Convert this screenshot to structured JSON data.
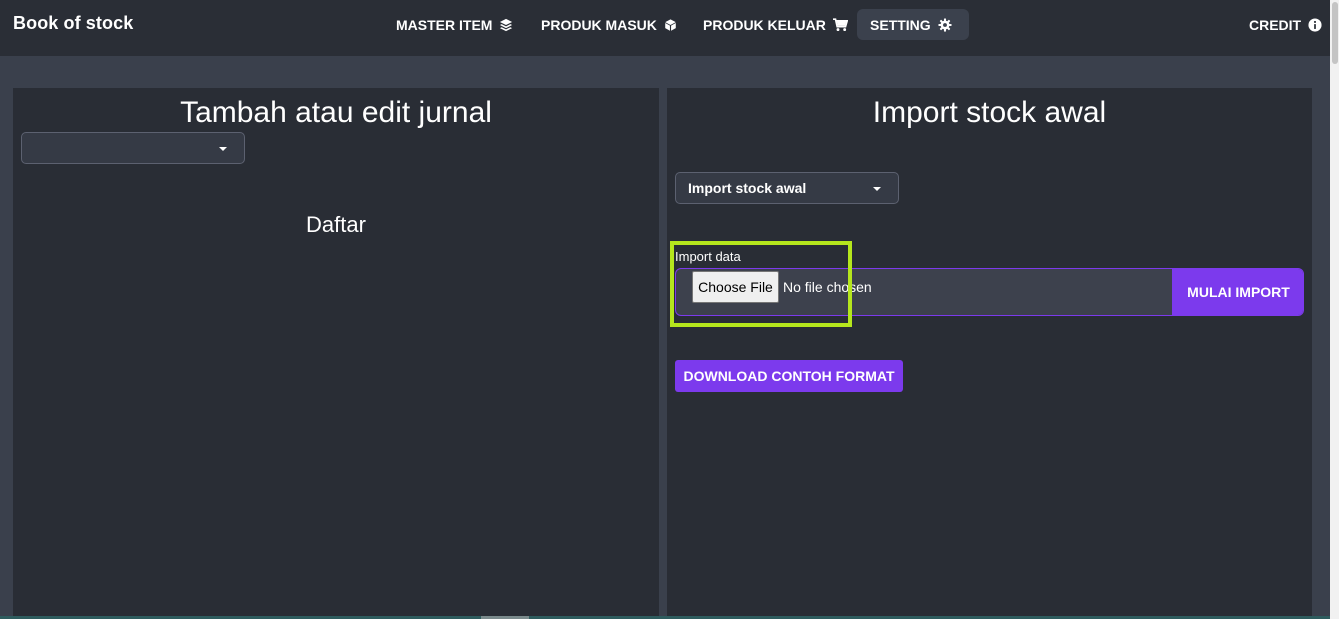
{
  "brand": "Book of stock",
  "nav": {
    "master_item": "MASTER ITEM",
    "produk_masuk": "PRODUK MASUK",
    "produk_keluar": "PRODUK KELUAR",
    "setting": "SETTING",
    "credit": "CREDIT",
    "active": "setting"
  },
  "left_panel": {
    "title": "Tambah atau edit jurnal",
    "select_value": "",
    "subtitle": "Daftar"
  },
  "right_panel": {
    "title": "Import stock awal",
    "select_value": "Import stock awal",
    "import_label": "Import data",
    "choose_file_label": "Choose File",
    "no_file_text": "No file chosen",
    "mulai_import_label": "MULAI IMPORT",
    "download_label": "DOWNLOAD CONTOH FORMAT"
  },
  "colors": {
    "accent": "#7c3aed",
    "highlight": "#b5e61d",
    "navbar_bg": "#2a2e36",
    "panel_bg": "#292d35",
    "page_bg": "#3a404c"
  },
  "icons": {
    "master_item": "layers-icon",
    "produk_masuk": "cube-icon",
    "produk_keluar": "cart-icon",
    "setting": "gear-icon",
    "credit": "info-circle-icon",
    "select_caret": "caret-down-icon"
  }
}
